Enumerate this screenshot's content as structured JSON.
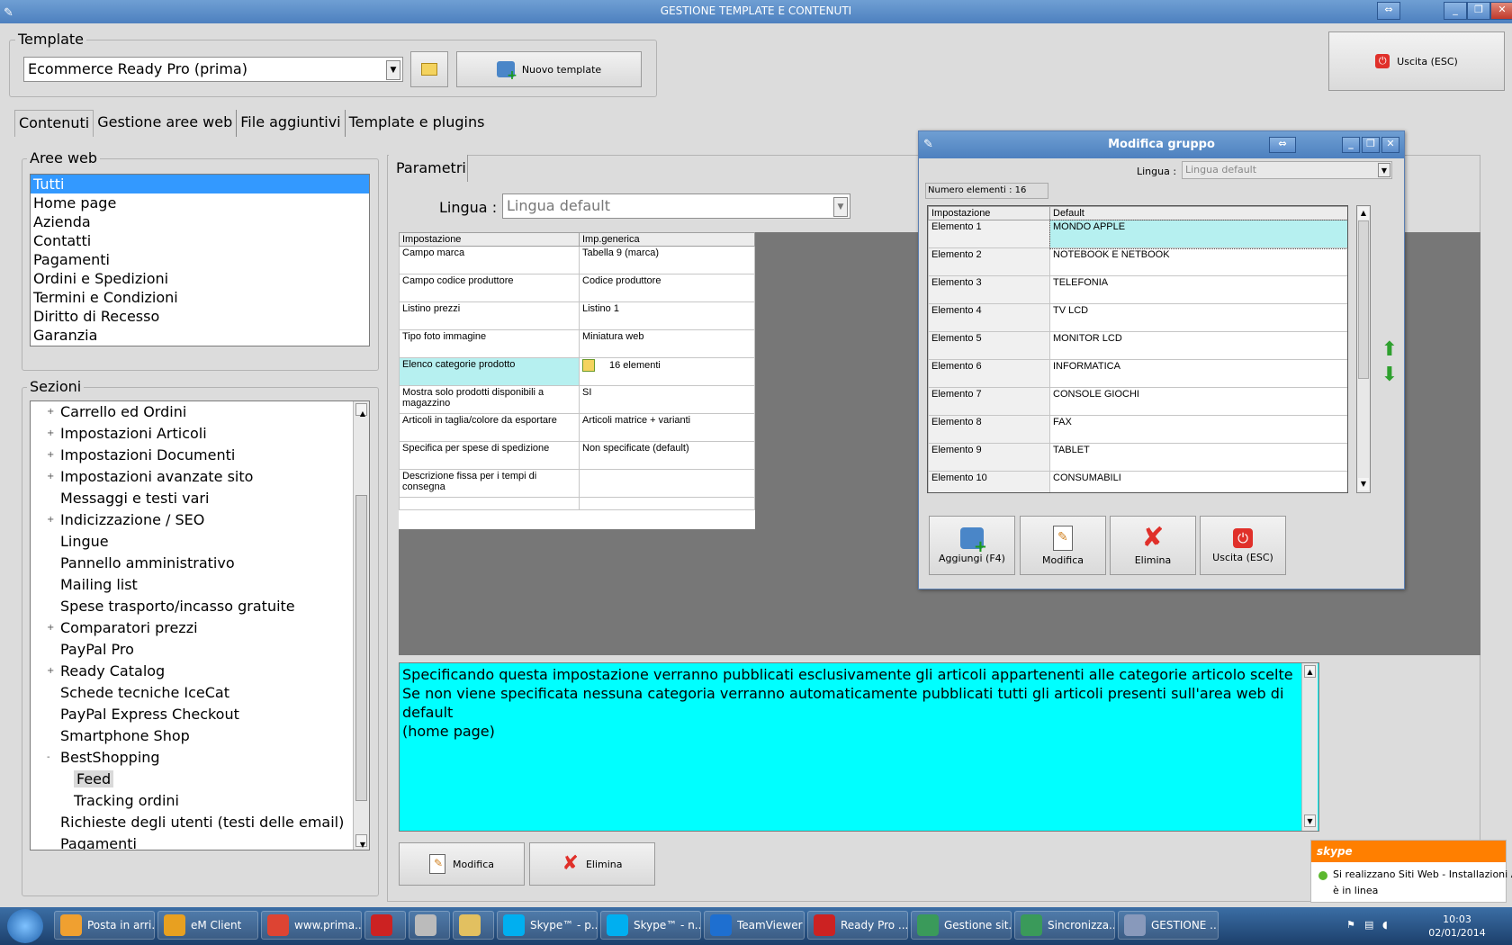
{
  "window": {
    "title": "GESTIONE TEMPLATE E CONTENUTI"
  },
  "template": {
    "legend": "Template",
    "selected": "Ecommerce Ready Pro (prima)",
    "new_button": "Nuovo template",
    "exit_button": "Uscita (ESC)"
  },
  "tabs": [
    "Contenuti",
    "Gestione aree web",
    "File aggiuntivi",
    "Template e plugins"
  ],
  "aree_web": {
    "legend": "Aree web",
    "items": [
      "Tutti",
      "Home page",
      "Azienda",
      "Contatti",
      "Pagamenti",
      "Ordini e Spedizioni",
      "Termini e Condizioni",
      "Diritto di Recesso",
      "Garanzia"
    ]
  },
  "sezioni": {
    "legend": "Sezioni",
    "items": [
      {
        "label": "Carrello ed Ordini",
        "expander": "+"
      },
      {
        "label": "Impostazioni Articoli",
        "expander": "+"
      },
      {
        "label": "Impostazioni Documenti",
        "expander": "+"
      },
      {
        "label": "Impostazioni avanzate sito",
        "expander": "+"
      },
      {
        "label": "Messaggi e testi vari",
        "expander": ""
      },
      {
        "label": "Indicizzazione / SEO",
        "expander": "+"
      },
      {
        "label": "Lingue",
        "expander": ""
      },
      {
        "label": "Pannello amministrativo",
        "expander": ""
      },
      {
        "label": "Mailing list",
        "expander": ""
      },
      {
        "label": "Spese trasporto/incasso gratuite",
        "expander": ""
      },
      {
        "label": "Comparatori prezzi",
        "expander": "+"
      },
      {
        "label": "PayPal Pro",
        "expander": ""
      },
      {
        "label": "Ready Catalog",
        "expander": "+"
      },
      {
        "label": "Schede tecniche IceCat",
        "expander": ""
      },
      {
        "label": "PayPal Express Checkout",
        "expander": ""
      },
      {
        "label": "Smartphone Shop",
        "expander": ""
      },
      {
        "label": "BestShopping",
        "expander": "-"
      },
      {
        "label": "Feed",
        "expander": "",
        "child": true,
        "selected": true
      },
      {
        "label": "Tracking ordini",
        "expander": "",
        "child": true
      },
      {
        "label": "Richieste degli utenti (testi delle email)",
        "expander": ""
      },
      {
        "label": "Pagamenti",
        "expander": ""
      }
    ]
  },
  "parametri": {
    "tab": "Parametri",
    "lingua_label": "Lingua :",
    "lingua_value": "Lingua default",
    "columns": [
      "Impostazione",
      "Imp.generica"
    ],
    "rows": [
      [
        "Campo marca",
        "Tabella 9 (marca)"
      ],
      [
        "Campo codice produttore",
        "Codice produttore"
      ],
      [
        "Listino prezzi",
        "Listino 1"
      ],
      [
        "Tipo foto immagine",
        "Miniatura web"
      ],
      [
        "Elenco categorie prodotto",
        "16 elementi"
      ],
      [
        "Mostra solo prodotti disponibili a magazzino",
        "SI"
      ],
      [
        "Articoli in taglia/colore da esportare",
        "Articoli matrice + varianti"
      ],
      [
        "Specifica per spese di spedizione",
        "Non specificate (default)"
      ],
      [
        "Descrizione fissa per i tempi di consegna",
        ""
      ]
    ],
    "description_lines": [
      "Specificando questa impostazione verranno pubblicati esclusivamente gli articoli appartenenti alle categorie articolo scelte",
      "Se non viene specificata nessuna categoria verranno automaticamente pubblicati tutti gli articoli presenti sull'area web di default",
      "(home page)"
    ],
    "modifica": "Modifica",
    "elimina": "Elimina"
  },
  "dialog": {
    "title": "Modifica gruppo",
    "lingua_label": "Lingua :",
    "lingua_value": "Lingua default",
    "count": "Numero elementi : 16",
    "columns": [
      "Impostazione",
      "Default"
    ],
    "rows": [
      [
        "Elemento 1",
        "MONDO APPLE"
      ],
      [
        "Elemento 2",
        "NOTEBOOK E NETBOOK"
      ],
      [
        "Elemento 3",
        "TELEFONIA"
      ],
      [
        "Elemento 4",
        "TV LCD"
      ],
      [
        "Elemento 5",
        "MONITOR LCD"
      ],
      [
        "Elemento 6",
        "INFORMATICA"
      ],
      [
        "Elemento 7",
        "CONSOLE GIOCHI"
      ],
      [
        "Elemento 8",
        "FAX"
      ],
      [
        "Elemento 9",
        "TABLET"
      ],
      [
        "Elemento 10",
        "CONSUMABILI"
      ]
    ],
    "buttons": [
      "Aggiungi (F4)",
      "Modifica",
      "Elimina",
      "Uscita (ESC)"
    ]
  },
  "skype_toast": {
    "brand": "skype",
    "message": "Si realizzano Siti Web - Installazioni A...",
    "status": "è in linea"
  },
  "taskbar": {
    "items": [
      {
        "label": "Posta in arri...",
        "color": "#f0a030"
      },
      {
        "label": "eM Client",
        "color": "#e8a020"
      },
      {
        "label": "www.prima...",
        "color": "#dd4433"
      },
      {
        "label": "",
        "color": "#cc2222"
      },
      {
        "label": "",
        "color": "#bbbbbb"
      },
      {
        "label": "",
        "color": "#e2c060"
      },
      {
        "label": "Skype™ - p...",
        "color": "#00aff0"
      },
      {
        "label": "Skype™ - n...",
        "color": "#00aff0"
      },
      {
        "label": "TeamViewer",
        "color": "#1e6fd0"
      },
      {
        "label": "Ready Pro ...",
        "color": "#cc2222"
      },
      {
        "label": "Gestione sit...",
        "color": "#3a9a5a"
      },
      {
        "label": "Sincronizza...",
        "color": "#3a9a5a"
      },
      {
        "label": "GESTIONE ...",
        "color": "#8899bb"
      }
    ],
    "time": "10:03",
    "date": "02/01/2014"
  }
}
